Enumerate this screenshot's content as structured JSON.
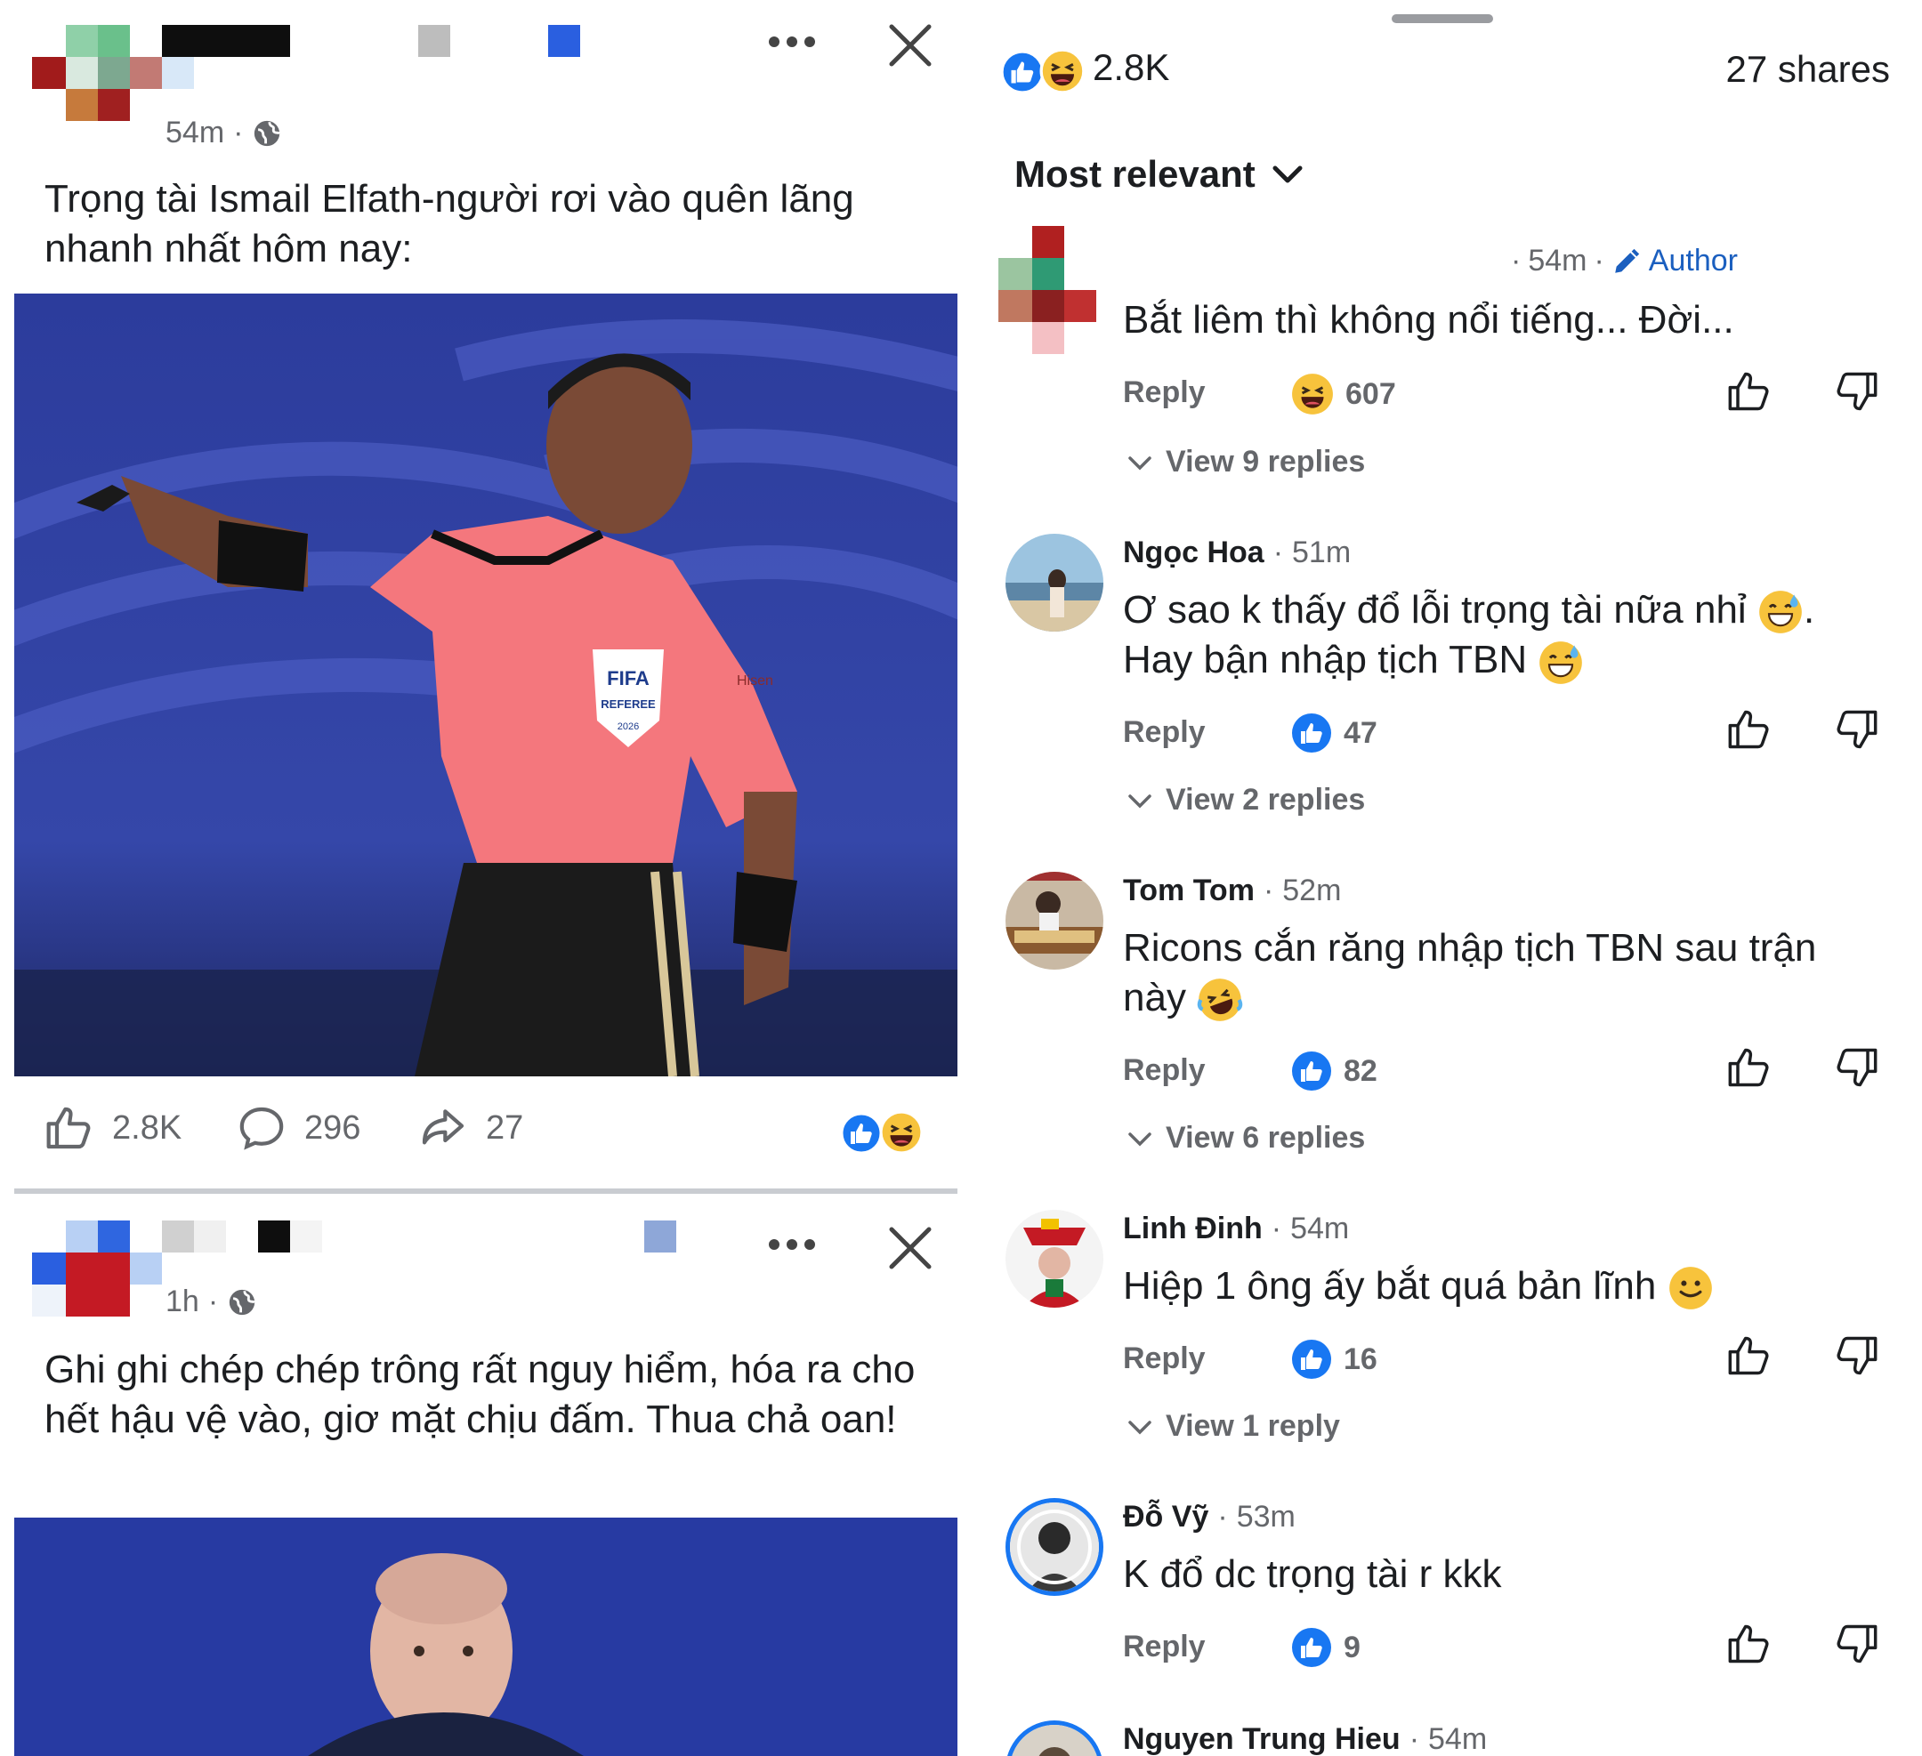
{
  "post1": {
    "time": "54m",
    "text": "Trọng tài Ismail Elfath-người rơi vào quên lãng nhanh nhất hôm nay:",
    "likes": "2.8K",
    "comments": "296",
    "shares": "27",
    "photo_text": {
      "badge_line1": "FIFA",
      "badge_line2": "REFEREE",
      "badge_year": "2026",
      "sponsor": "Hisen"
    }
  },
  "post2": {
    "time": "1h",
    "text": "Ghi ghi chép chép trông rất nguy hiểm, hóa ra cho hết hậu vệ vào, giơ mặt chịu đấm. Thua chả oan!"
  },
  "panel": {
    "reaction_count": "2.8K",
    "shares": "27 shares",
    "sort_label": "Most relevant"
  },
  "comments": [
    {
      "name": "",
      "time": "54m",
      "badge": "Author",
      "text": "Bắt liêm thì không nổi tiếng... Đời...",
      "reply": "Reply",
      "reaction_count": "607",
      "view": "View 9 replies"
    },
    {
      "name": "Ngọc Hoa",
      "time": "51m",
      "text_line1": "Ơ sao k thấy đổ lỗi trọng tài nữa nhỉ",
      "text_line1_end": ".",
      "text_line2": "Hay bận nhập tịch TBN",
      "reply": "Reply",
      "reaction_count": "47",
      "view": "View 2 replies"
    },
    {
      "name": "Tom Tom",
      "time": "52m",
      "text_line1": "Ricons cắn răng nhập tịch TBN sau trận",
      "text_line2": "này",
      "reply": "Reply",
      "reaction_count": "82",
      "view": "View 6 replies"
    },
    {
      "name": "Linh Đinh",
      "time": "54m",
      "text": "Hiệp 1 ông ấy bắt quá bản lĩnh",
      "reply": "Reply",
      "reaction_count": "16",
      "view": "View 1 reply"
    },
    {
      "name": "Đỗ Vỹ",
      "time": "53m",
      "text": "K đổ dc trọng tài r kkk",
      "reply": "Reply",
      "reaction_count": "9"
    },
    {
      "name": "Nguyen Trung Hieu",
      "time": "54m"
    }
  ],
  "colors": {
    "like_blue": "#1877f2",
    "text_gray": "#65676b",
    "author_blue": "#1b5fbf",
    "pitch_blue": "#2f3fa0",
    "jersey_pink": "#f4777d"
  }
}
